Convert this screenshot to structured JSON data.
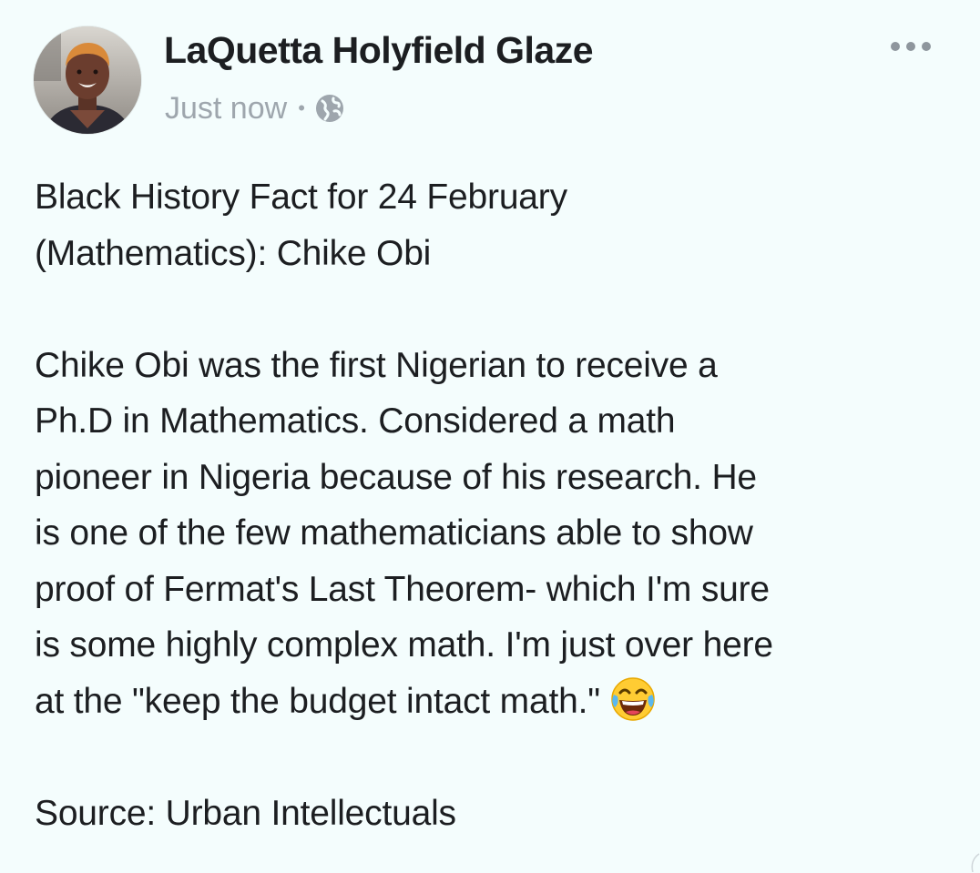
{
  "post": {
    "author_name": "LaQuetta Holyfield Glaze",
    "timestamp": "Just now",
    "separator": "•",
    "privacy_icon": "globe-icon",
    "more_icon": "more-options-icon",
    "avatar_icon": "profile-photo"
  },
  "content": {
    "heading_line1": "Black History Fact for 24 February",
    "heading_line2": "(Mathematics): Chike Obi",
    "para_line1": "Chike Obi was the first Nigerian to receive a",
    "para_line2": "Ph.D in Mathematics. Considered a math",
    "para_line3": "pioneer in Nigeria because of his research. He",
    "para_line4": "is one of the few mathematicians able to show",
    "para_line5": "proof of Fermat's Last Theorem- which I'm sure",
    "para_line6": "is some highly complex math. I'm just over here",
    "para_line7": "at the \"keep the budget intact math.\"",
    "emoji": "face-with-tears-of-joy-emoji",
    "source": "Source: Urban Intellectuals"
  },
  "colors": {
    "background": "#f4fdfd",
    "name_text": "#1c1e21",
    "meta_text": "#9ea6ad"
  }
}
